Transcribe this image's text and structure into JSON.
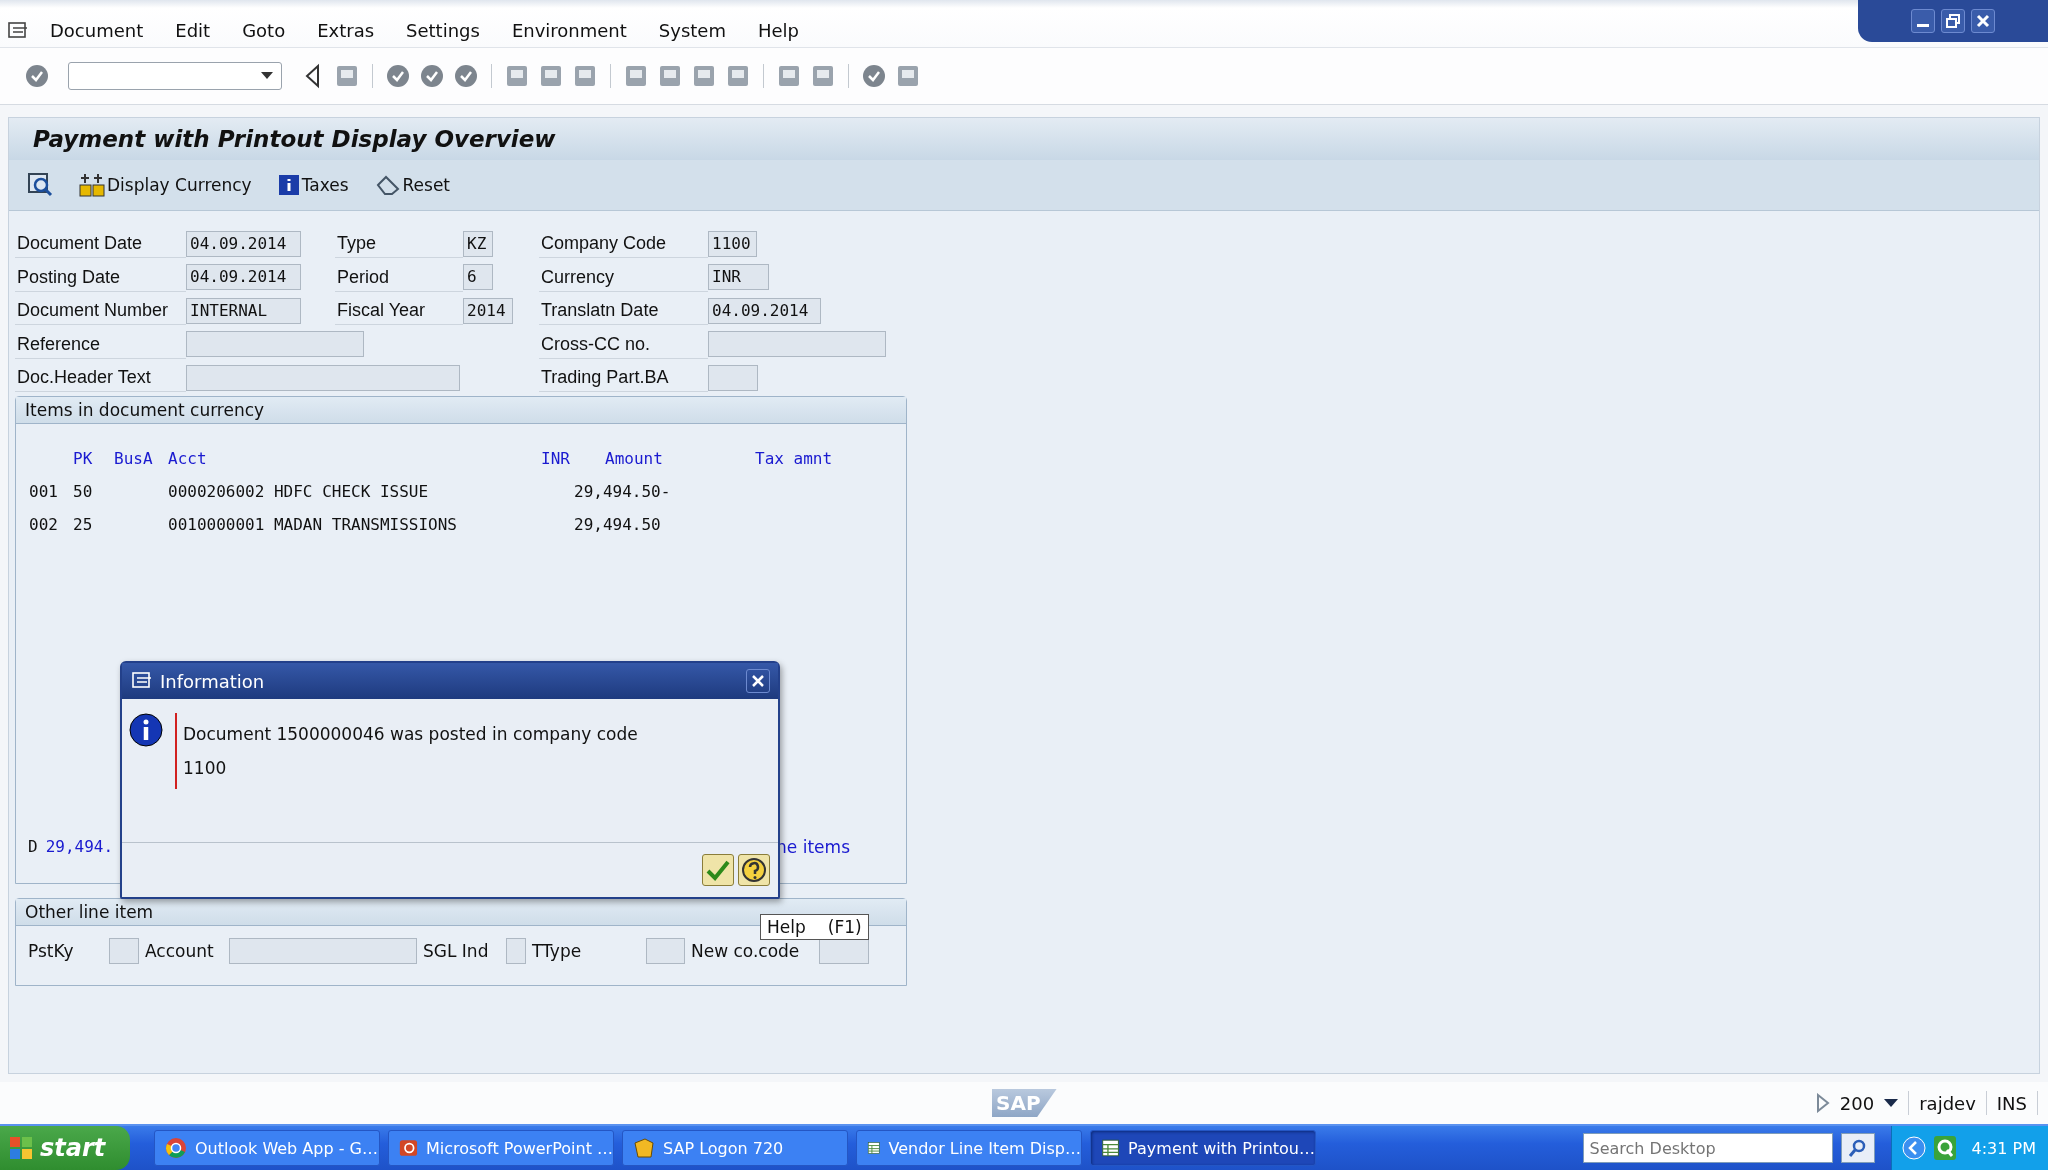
{
  "menu": [
    {
      "label": "Document"
    },
    {
      "label": "Edit"
    },
    {
      "label": "Goto"
    },
    {
      "label": "Extras"
    },
    {
      "label": "Settings"
    },
    {
      "label": "Environment"
    },
    {
      "label": "System"
    },
    {
      "label": "Help"
    }
  ],
  "title": "Payment with Printout Display Overview",
  "app_toolbar": [
    {
      "label": "Display Currency"
    },
    {
      "label": "Taxes"
    },
    {
      "label": "Reset"
    }
  ],
  "header_fields": [
    [
      {
        "label": "Document Date",
        "value": "04.09.2014"
      },
      {
        "label": "Posting Date",
        "value": "04.09.2014"
      },
      {
        "label": "Document Number",
        "value": "INTERNAL"
      },
      {
        "label": "Reference"
      },
      {
        "label": "Doc.Header Text"
      }
    ],
    [
      {
        "label": "Type",
        "value": "KZ"
      },
      {
        "label": "Period",
        "value": "6"
      },
      {
        "label": "Fiscal Year",
        "value": "2014"
      }
    ],
    [
      {
        "label": "Company Code",
        "value": "1100"
      },
      {
        "label": "Currency",
        "value": "INR"
      },
      {
        "label": "Translatn Date",
        "value": "04.09.2014"
      },
      {
        "label": "Cross-CC no."
      },
      {
        "label": "Trading Part.BA"
      }
    ]
  ],
  "items": {
    "title": "Items in document currency",
    "columns": [
      "PK",
      "BusA",
      "Acct",
      "INR",
      "Amount",
      "Tax amnt"
    ],
    "rows": [
      {
        "item": "001",
        "pk": "50",
        "acct": "0000206002 HDFC CHECK ISSUE",
        "amount": "29,494.50-"
      },
      {
        "item": "002",
        "pk": "25",
        "acct": "0010000001 MADAN TRANSMISSIONS",
        "amount": "29,494.50"
      }
    ],
    "footer": {
      "prefix": "D",
      "amount": "29,494.",
      "link": "ne items"
    }
  },
  "other_line_item": {
    "title": "Other line item",
    "fields": [
      {
        "label": "PstKy"
      },
      {
        "label": "Account"
      },
      {
        "label": "SGL Ind"
      },
      {
        "label": "TType"
      },
      {
        "label": "New co.code"
      }
    ]
  },
  "dialog": {
    "title": "Information",
    "message": "Document 1500000046 was posted in company code 1100"
  },
  "tooltip": {
    "label": "Help",
    "key": "(F1)"
  },
  "status_bar": {
    "logo": "SAP",
    "client": "200",
    "user": "rajdev",
    "mode": "INS"
  },
  "taskbar": {
    "start": "start",
    "tasks": [
      {
        "label": "Outlook Web App - G…",
        "selected": false
      },
      {
        "label": "Microsoft PowerPoint …",
        "selected": false
      },
      {
        "label": "SAP Logon 720",
        "selected": false
      },
      {
        "label": "Vendor Line Item Disp…",
        "selected": false
      },
      {
        "label": "Payment with Printou…",
        "selected": true
      }
    ],
    "search": {
      "placeholder": "Search Desktop"
    },
    "clock": "4:31 PM"
  }
}
